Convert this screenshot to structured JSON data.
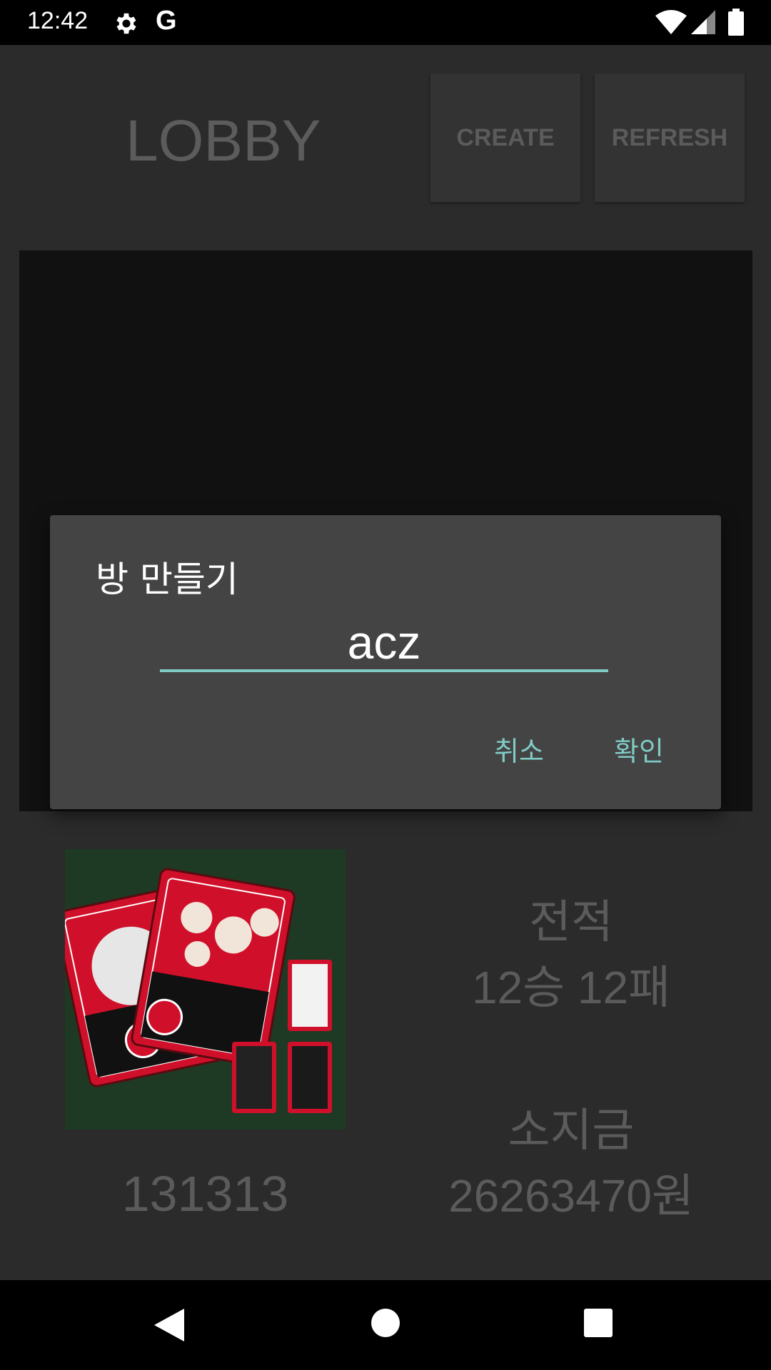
{
  "status_bar": {
    "time": "12:42",
    "icons": [
      "gear-icon",
      "google-g-icon",
      "wifi-icon",
      "signal-icon",
      "battery-icon"
    ],
    "g_label": "G"
  },
  "header": {
    "title": "LOBBY",
    "create_label": "CREATE",
    "refresh_label": "REFRESH"
  },
  "profile": {
    "user_name": "131313",
    "record_label": "전적",
    "record_value": "12승 12패",
    "money_label": "소지금",
    "money_value": "26263470원"
  },
  "dialog": {
    "title": "방 만들기",
    "input_value": "acz",
    "cancel_label": "취소",
    "ok_label": "확인"
  },
  "colors": {
    "accent": "#80cbc4",
    "dialog_bg": "#444444",
    "background": "#2b2b2b"
  }
}
